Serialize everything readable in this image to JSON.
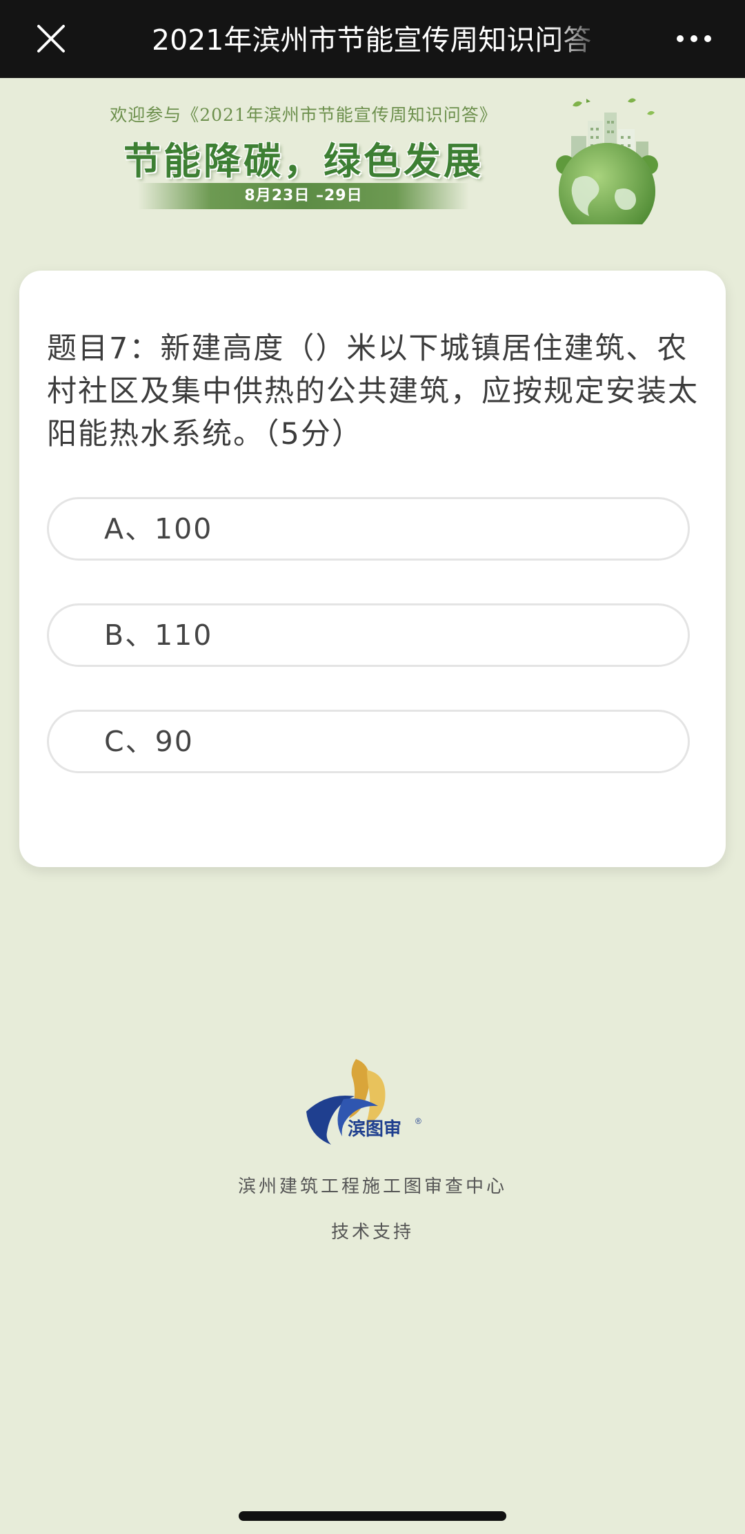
{
  "nav": {
    "title": "2021年滨州市节能宣传周知识问答",
    "close_icon": "close-icon",
    "more_icon": "more-icon"
  },
  "banner": {
    "welcome": "欢迎参与《2021年滨州市节能宣传周知识问答》",
    "slogan": "节能降碳，绿色发展",
    "date": "8月23日 –29日",
    "illustration": "green-earth-city-illustration"
  },
  "question": {
    "text": "题目7：新建高度（）米以下城镇居住建筑、农村社区及集中供热的公共建筑，应按规定安装太阳能热水系统。（5分）",
    "options": [
      {
        "label": "A、100"
      },
      {
        "label": "B、110"
      },
      {
        "label": "C、90"
      }
    ]
  },
  "footer": {
    "logo_text": "滨图审",
    "organization": "滨州建筑工程施工图审查中心",
    "support": "技术支持"
  },
  "colors": {
    "page_background": "#e7ecd9",
    "topbar": "#141414",
    "slogan_green": "#3d7f33",
    "logo_blue": "#1f3f8f",
    "logo_gold": "#d9a53a"
  }
}
